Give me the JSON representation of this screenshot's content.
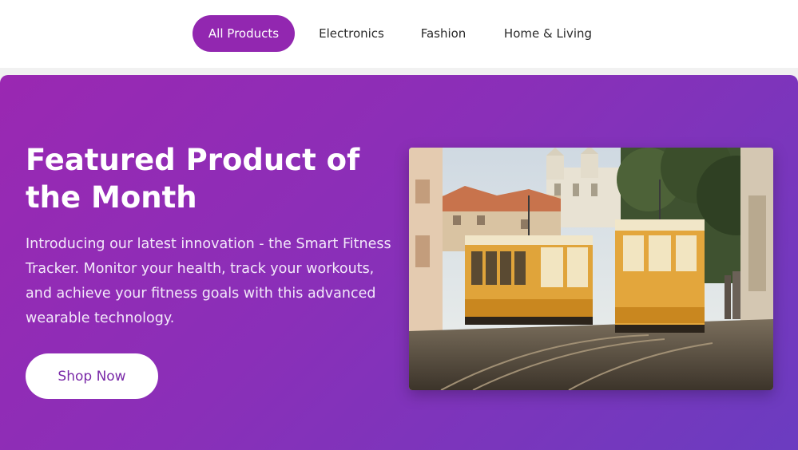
{
  "nav": {
    "items": [
      {
        "label": "All Products",
        "active": true
      },
      {
        "label": "Electronics",
        "active": false
      },
      {
        "label": "Fashion",
        "active": false
      },
      {
        "label": "Home & Living",
        "active": false
      }
    ]
  },
  "hero": {
    "title": "Featured Product of the Month",
    "description": "Introducing our latest innovation - the Smart Fitness Tracker. Monitor your health, track your workouts, and achieve your fitness goals with this advanced wearable technology.",
    "button_label": "Shop Now",
    "image_alt": "Yellow vintage trams on a cobblestone street in front of a white church"
  },
  "colors": {
    "accent": "#9227b0",
    "hero_gradient_start": "#9a28b2",
    "hero_gradient_end": "#6b3cc0",
    "button_text": "#7a2aa8"
  }
}
